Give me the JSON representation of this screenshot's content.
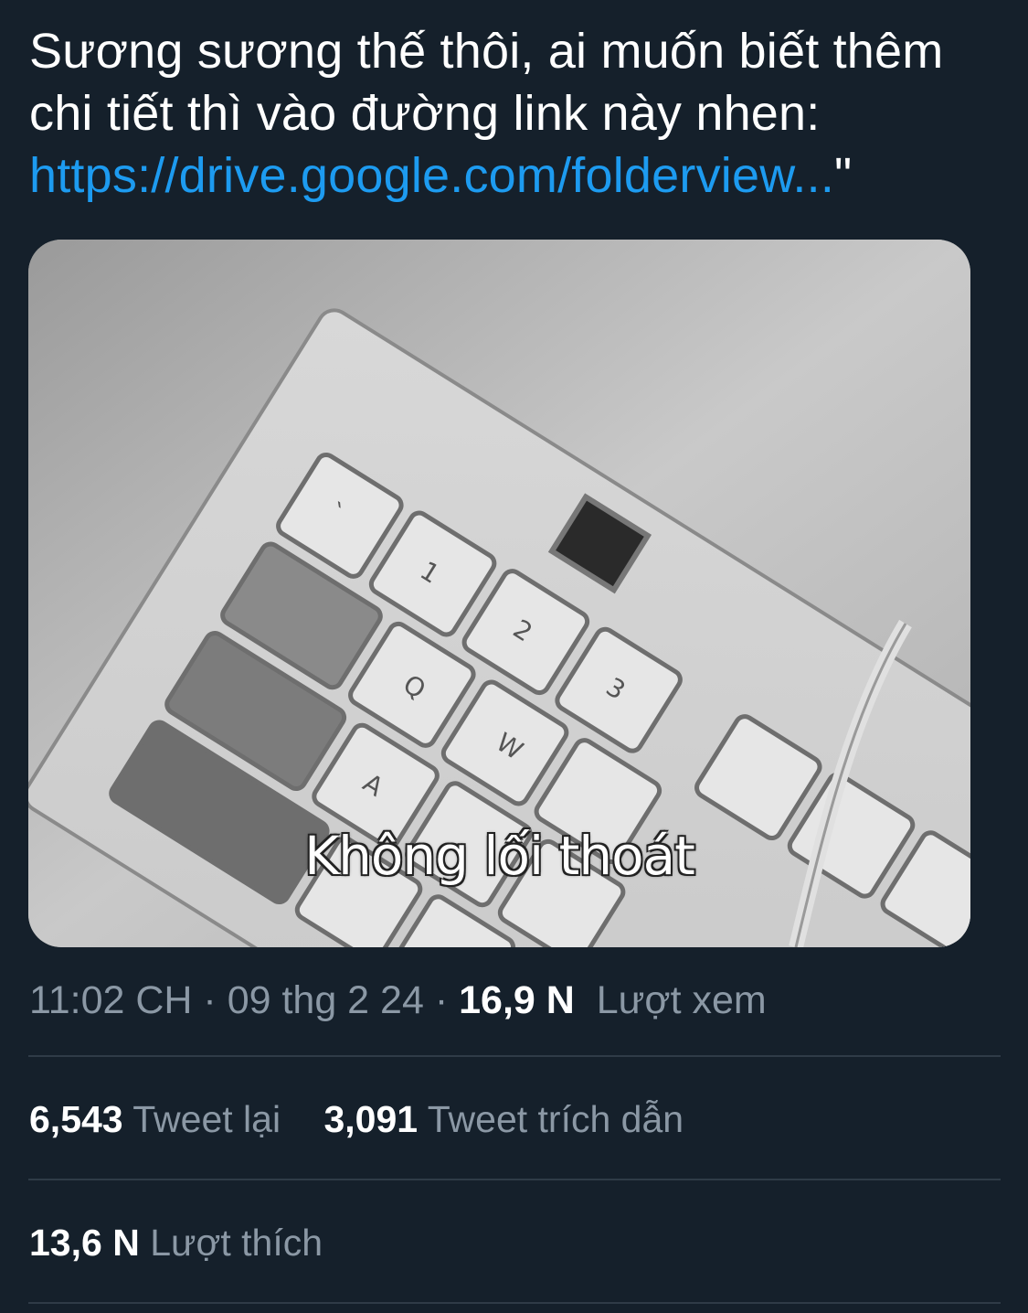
{
  "tweet": {
    "text_line1": "Sương sương thế thôi, ai muốn biết thêm",
    "text_line2": "chi tiết thì vào đường link này nhen:",
    "link": "https://drive.google.com/folderview...",
    "closing_quote": "\""
  },
  "media": {
    "caption": "Không lối thoát",
    "description_icon": "keyboard-photo"
  },
  "meta": {
    "time": "11:02 CH",
    "sep1": " · ",
    "date": "09 thg 2 24",
    "sep2": " · ",
    "views_count": "16,9 N",
    "views_label": "Lượt xem"
  },
  "stats": {
    "retweets_count": "6,543",
    "retweets_label": "Tweet lại",
    "quotes_count": "3,091",
    "quotes_label": "Tweet trích dẫn",
    "likes_count": "13,6 N",
    "likes_label": "Lượt thích"
  },
  "colors": {
    "background": "#15202b",
    "link": "#1d9bf0",
    "secondary_text": "#8b98a5",
    "divider": "#2f3b47"
  }
}
